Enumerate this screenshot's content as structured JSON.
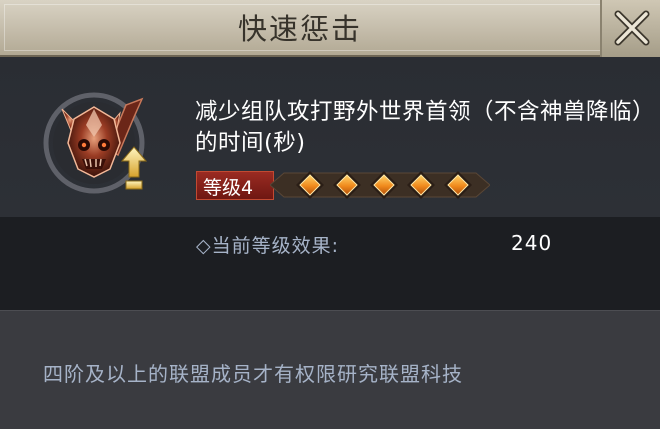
{
  "dialog": {
    "title": "快速惩击"
  },
  "skill": {
    "icon": "demon-skull-emblem-icon",
    "description": "减少组队攻打野外世界首领（不含神兽降临）的时间(秒)",
    "level_label": "等级4",
    "level_current": 4,
    "level_diamonds_filled": 5,
    "current_effect_label": "◇当前等级效果:",
    "current_effect_value": "240"
  },
  "footer": {
    "note": "四阶及以上的联盟成员才有权限研究联盟科技"
  },
  "colors": {
    "title_bar": "#c9c1ae",
    "panel": "#2b2e34",
    "badge_red": "#8a2219",
    "diamond_orange": "#f08a1c",
    "muted_text": "#a6b3c8"
  }
}
